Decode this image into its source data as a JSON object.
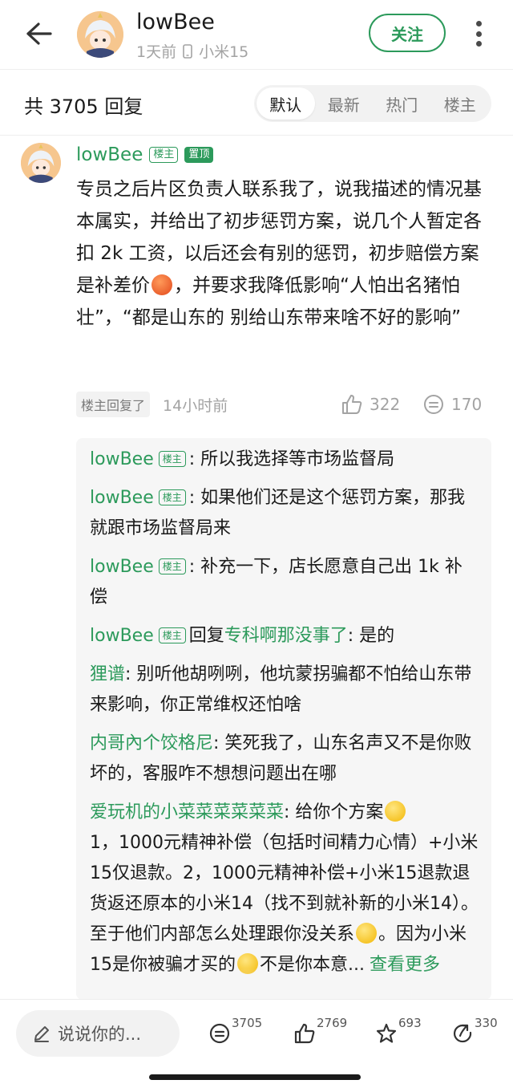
{
  "header": {
    "username": "lowBee",
    "time": "1天前",
    "device": "小米15",
    "follow_label": "关注"
  },
  "reply_bar": {
    "count_text": "共 3705 回复",
    "sort_tabs": [
      "默认",
      "最新",
      "热门",
      "楼主"
    ],
    "active_tab": "默认"
  },
  "post": {
    "username": "lowBee",
    "op_tag": "楼主",
    "pinned_tag": "置顶",
    "body_part1": "专员之后片区负责人联系我了，说我描述的情况基本属实，并给出了初步惩罚方案，说几个人暂定各扣 2k 工资，以后还会有别的惩罚，初步赔偿方案是补差价",
    "body_part2": "，并要求我降低影响“人怕出名猪怕壮”，“都是山东的 别给山东带来啥不好的影响”",
    "op_replied": "楼主回复了",
    "time": "14小时前",
    "likes": "322",
    "comments": "170"
  },
  "replies": [
    {
      "name": "lowBee",
      "tag": "楼主",
      "text": ": 所以我选择等市场监督局"
    },
    {
      "name": "lowBee",
      "tag": "楼主",
      "text": ": 如果他们还是这个惩罚方案，那我就跟市场监督局来"
    },
    {
      "name": "lowBee",
      "tag": "楼主",
      "text": ": 补充一下，店长愿意自己出 1k 补偿"
    },
    {
      "name": "lowBee",
      "tag": "楼主",
      "reply_word": "回复",
      "reply_to": "专科啊那没事了",
      "text": ": 是的"
    },
    {
      "name": "狸谱",
      "text": ": 别听他胡咧咧，他坑蒙拐骗都不怕给山东带来影响，你正常维权还怕啥"
    },
    {
      "name": "内哥內个饺格尼",
      "text": ": 笑死我了，山东名声又不是你败坏的，客服咋不想想问题出在哪"
    },
    {
      "name": "爱玩机的小菜菜菜菜菜菜",
      "text_a": ": 给你个方案",
      "text_b": "1，1000元精神补偿（包括时间精力心情）+小米15仅退款。2，1000元精神补偿+小米15退款退货返还原本的小米14（找不到就补新的小米14）。至于他们内部怎么处理跟你没关系",
      "text_c": "。因为小米15是你被骗才买的",
      "text_d": "不是你本意...",
      "more_link": "查看更多"
    }
  ],
  "bottom_bar": {
    "input_placeholder": "说说你的...",
    "comments": "3705",
    "likes": "2769",
    "favorites": "693",
    "shares": "330"
  },
  "colors": {
    "accent_green": "#2c9a5b",
    "muted_gray": "#a3a3a3"
  }
}
